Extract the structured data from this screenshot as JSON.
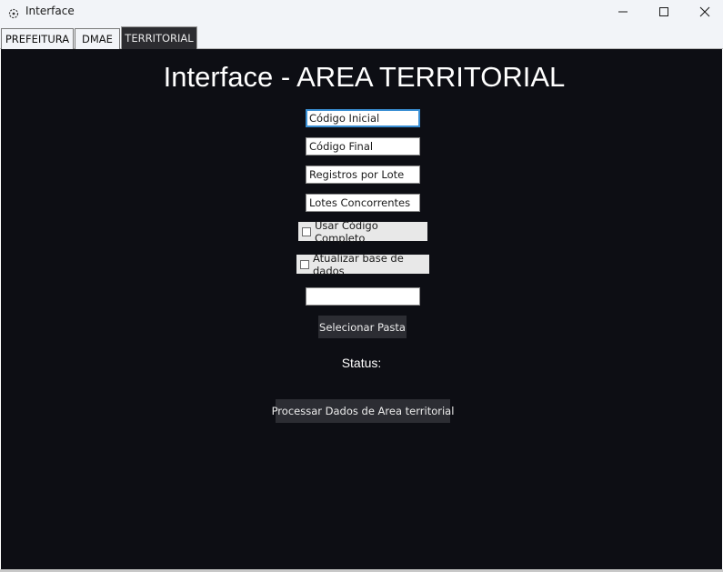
{
  "window": {
    "title": "Interface",
    "controls": [
      "minimize-icon",
      "maximize-icon",
      "close-icon"
    ]
  },
  "tabs": [
    {
      "label": "PREFEITURA",
      "active": false
    },
    {
      "label": "DMAE",
      "active": false
    },
    {
      "label": "TERRITORIAL",
      "active": true
    }
  ],
  "main": {
    "title": "Interface - AREA TERRITORIAL",
    "fields": {
      "codigo_inicial": "Código Inicial",
      "codigo_final": "Código Final",
      "registros_por_lote": "Registros por Lote",
      "lotes_concorrentes": "Lotes Concorrentes",
      "pasta": ""
    },
    "checkboxes": {
      "usar_codigo_completo": {
        "label": "Usar Código Completo",
        "checked": false
      },
      "atualizar_base": {
        "label": "Atualizar base de dados",
        "checked": false
      }
    },
    "select_folder_label": "Selecionar Pasta",
    "status_label": "Status:",
    "process_label": "Processar Dados de Area territorial"
  },
  "colors": {
    "background": "#0d0e14",
    "button": "#2c2d33",
    "focus": "#3a8fd4"
  }
}
